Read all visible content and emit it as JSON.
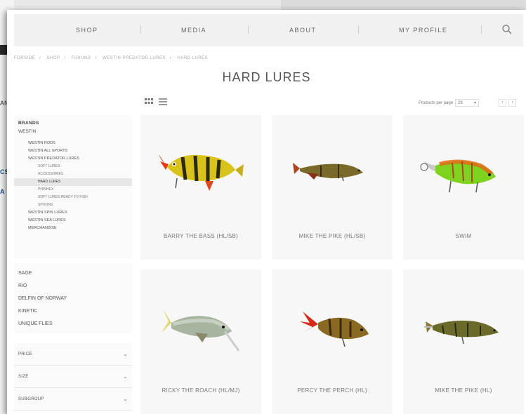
{
  "background": {
    "left_snippets": [
      "AN",
      "CS",
      "A"
    ]
  },
  "nav": {
    "items": [
      "SHOP",
      "MEDIA",
      "ABOUT",
      "MY PROFILE"
    ],
    "search_icon": "search-icon"
  },
  "breadcrumb": [
    "FORSIDE",
    "SHOP",
    "FISHING",
    "WESTIN PREDATOR LURES",
    "HARD LURES"
  ],
  "page_title": "HARD LURES",
  "toolbar": {
    "per_page_label": "Products per page",
    "per_page_value": "28",
    "pager": [
      "‹",
      "›"
    ]
  },
  "sidebar": {
    "head": "BRANDS",
    "brand": "WESTIN",
    "tree": [
      {
        "label": "WESTIN RODS",
        "level": 1,
        "active": false
      },
      {
        "label": "WESTIN ALL SPORTS",
        "level": 1,
        "active": false
      },
      {
        "label": "WESTIN PREDATOR LURES",
        "level": 1,
        "active": false
      },
      {
        "label": "SOFT LURES",
        "level": 2,
        "active": false
      },
      {
        "label": "ACCESSORIES",
        "level": 2,
        "active": false
      },
      {
        "label": "HARD LURES",
        "level": 2,
        "active": true
      },
      {
        "label": "PHINHEX",
        "level": 2,
        "active": false
      },
      {
        "label": "SOFT LURES READY TO FISH",
        "level": 2,
        "active": false
      },
      {
        "label": "SPOONS",
        "level": 2,
        "active": false
      },
      {
        "label": "WESTIN SPIN LURES",
        "level": 1,
        "active": false
      },
      {
        "label": "WESTIN SEA LURES",
        "level": 1,
        "active": false
      },
      {
        "label": "MERCHANDISE",
        "level": 1,
        "active": false
      }
    ],
    "other_brands": [
      "SAGE",
      "RIO",
      "DELFIN OF NORWAY",
      "KINETIC",
      "UNIQUE FLIES"
    ],
    "filters": [
      "PRICE",
      "SIZE",
      "SUBGROUP"
    ]
  },
  "products": [
    {
      "name": "BARRY THE BASS (HL/SB)",
      "lure": "bass"
    },
    {
      "name": "MIKE THE PIKE (HL/SB)",
      "lure": "pike-dark"
    },
    {
      "name": "SWIM",
      "lure": "swim"
    },
    {
      "name": "RICKY THE ROACH (HL/MJ)",
      "lure": "roach"
    },
    {
      "name": "PERCY THE PERCH (HL)",
      "lure": "perch"
    },
    {
      "name": "MIKE THE PIKE (HL)",
      "lure": "pike-light"
    }
  ],
  "colors": {
    "nav_bg": "#f1f1f1",
    "card_bg": "#f7f7f7",
    "text": "#555555"
  }
}
